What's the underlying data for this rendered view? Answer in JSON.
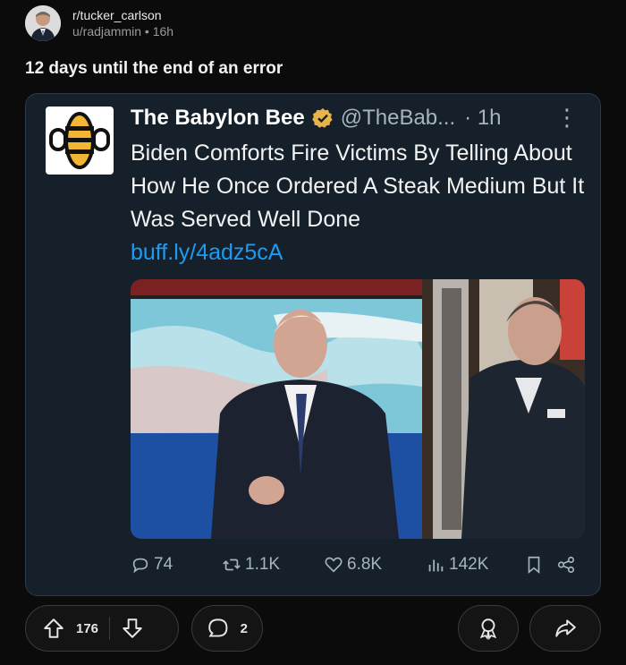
{
  "post": {
    "subreddit": "r/tucker_carlson",
    "user": "u/radjammin",
    "age": "16h",
    "separator": "•",
    "title": "12 days until the end of an error"
  },
  "tweet": {
    "name": "The Babylon Bee",
    "handle": "@TheBab...",
    "time": "· 1h",
    "more": "⋮",
    "text": "Biden Comforts Fire Victims By Telling About How He Once Ordered A Steak Medium But It Was Served Well Done",
    "link": "buff.ly/4adz5cA",
    "stats": {
      "replies": "74",
      "retweets": "1.1K",
      "likes": "6.8K",
      "views": "142K"
    }
  },
  "actions": {
    "upvotes": "176",
    "comments": "2"
  },
  "icons": [
    "avatar",
    "babylon-bee-logo",
    "verified-badge-icon",
    "more-icon",
    "reply-icon",
    "retweet-icon",
    "like-icon",
    "views-icon",
    "bookmark-icon",
    "share-icon",
    "upvote-icon",
    "downvote-icon",
    "comment-icon",
    "award-icon",
    "share-arrow-icon"
  ],
  "colors": {
    "link": "#1d9bf0",
    "card_bg": "#15202b",
    "verified": "#e8b34b"
  }
}
